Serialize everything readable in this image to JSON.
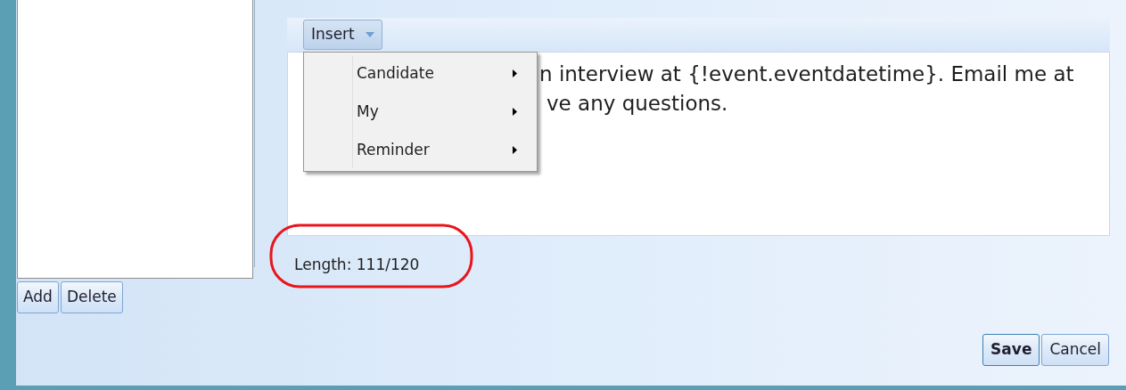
{
  "list_buttons": [
    {
      "label": "Add"
    },
    {
      "label": "Delete"
    }
  ],
  "insert_button": {
    "label": "Insert"
  },
  "insert_menu": {
    "items": [
      {
        "label": "Candidate",
        "has_submenu": true
      },
      {
        "label": "My",
        "has_submenu": true
      },
      {
        "label": "Reminder",
        "has_submenu": true
      }
    ]
  },
  "message_lines": [
    "n interview at {!event.eventdatetime}. Email me at",
    "ve any questions."
  ],
  "length_label": "Length: 111/120",
  "dialog_buttons": [
    {
      "label": "Save",
      "default": true
    },
    {
      "label": "Cancel",
      "default": false
    }
  ]
}
